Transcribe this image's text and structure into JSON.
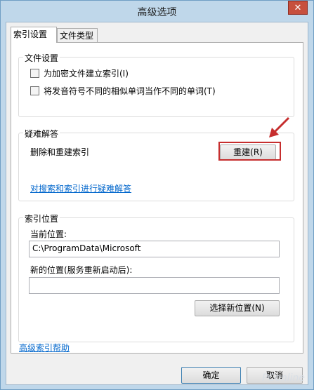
{
  "window": {
    "title": "高级选项",
    "close_glyph": "✕"
  },
  "tabs": [
    {
      "label": "索引设置"
    },
    {
      "label": "文件类型"
    }
  ],
  "file_settings": {
    "legend": "文件设置",
    "options": [
      {
        "label": "为加密文件建立索引(I)",
        "checked": false
      },
      {
        "label": "将发音符号不同的相似单词当作不同的单词(T)",
        "checked": false
      }
    ]
  },
  "troubleshoot": {
    "legend": "疑难解答",
    "rebuild_text": "删除和重建索引",
    "rebuild_button": "重建(R)",
    "link": "对搜索和索引进行疑难解答"
  },
  "index_location": {
    "legend": "索引位置",
    "current_label": "当前位置:",
    "current_value": "C:\\ProgramData\\Microsoft",
    "new_label": "新的位置(服务重新启动后):",
    "new_value": "",
    "select_button": "选择新位置(N)"
  },
  "footer": {
    "help_link": "高级索引帮助",
    "ok_button": "确定",
    "cancel_button": "取消"
  },
  "annotation": {
    "highlight_color": "#c62e2e"
  },
  "watermark": "PConline"
}
